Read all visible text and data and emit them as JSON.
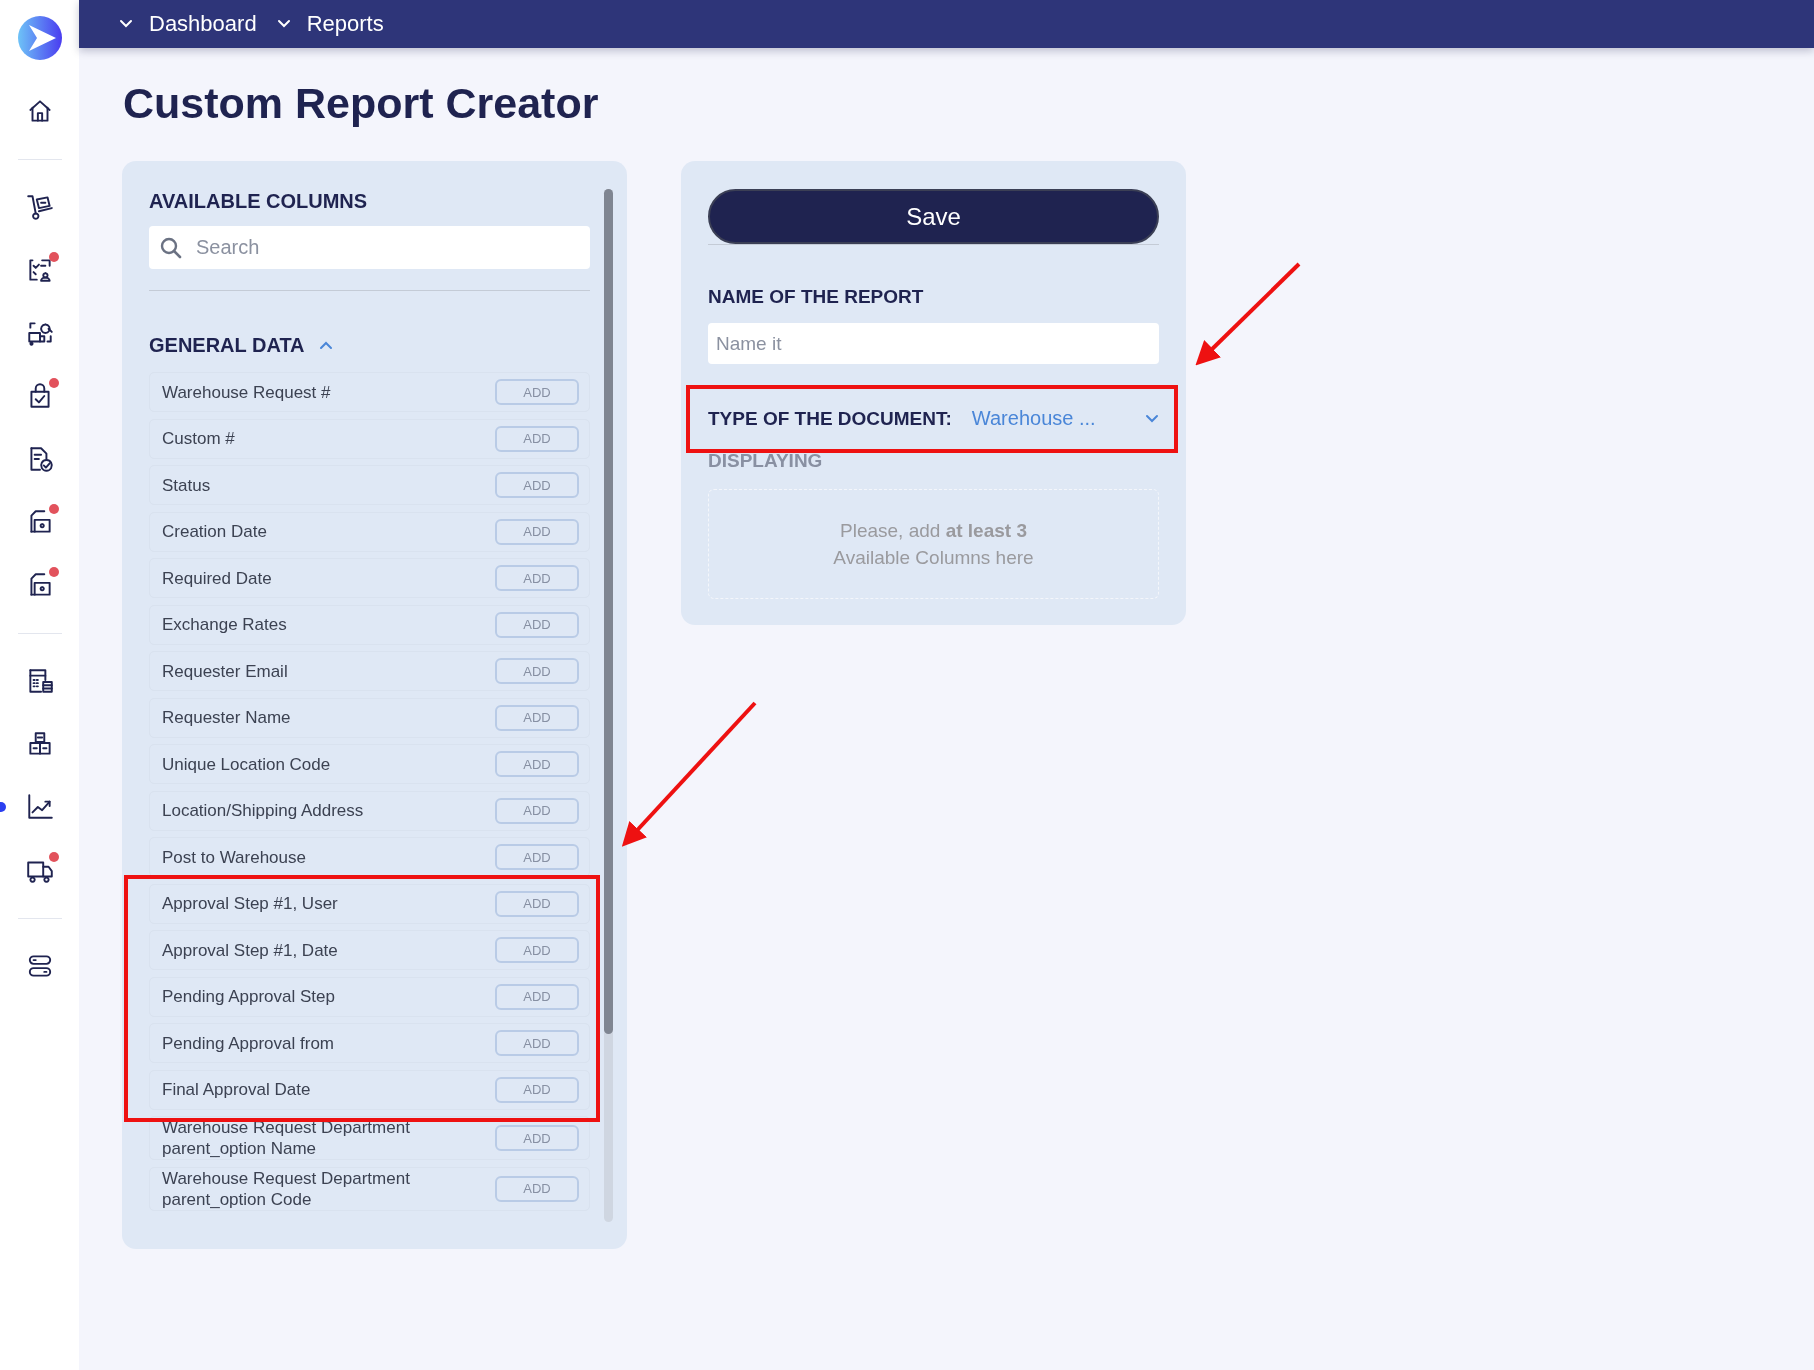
{
  "sidebar": {
    "groups": [
      [
        {
          "alert": false,
          "selected": false
        }
      ],
      [
        {
          "alert": false,
          "selected": false
        },
        {
          "alert": true,
          "selected": false
        },
        {
          "alert": false,
          "selected": false
        },
        {
          "alert": true,
          "selected": false
        },
        {
          "alert": false,
          "selected": false
        },
        {
          "alert": true,
          "selected": false
        },
        {
          "alert": true,
          "selected": false
        }
      ],
      [
        {
          "alert": false,
          "selected": false
        },
        {
          "alert": false,
          "selected": false
        },
        {
          "alert": false,
          "selected": true
        },
        {
          "alert": true,
          "selected": false
        }
      ],
      [
        {
          "alert": false,
          "selected": false
        }
      ]
    ]
  },
  "breadcrumbs": [
    {
      "label": "Dashboard"
    },
    {
      "label": "Reports"
    }
  ],
  "title": "Custom Report Creator",
  "available_columns": {
    "heading": "AVAILABLE COLUMNS",
    "search": {
      "placeholder": "Search"
    },
    "section": {
      "title": "GENERAL DATA",
      "expanded": true
    },
    "rows": [
      {
        "label": "Warehouse Request #",
        "action": "ADD"
      },
      {
        "label": "Custom #",
        "action": "ADD"
      },
      {
        "label": "Status",
        "action": "ADD"
      },
      {
        "label": "Creation Date",
        "action": "ADD"
      },
      {
        "label": "Required Date",
        "action": "ADD"
      },
      {
        "label": "Exchange Rates",
        "action": "ADD"
      },
      {
        "label": "Requester Email",
        "action": "ADD"
      },
      {
        "label": "Requester Name",
        "action": "ADD"
      },
      {
        "label": "Unique Location Code",
        "action": "ADD"
      },
      {
        "label": "Location/Shipping Address",
        "action": "ADD"
      },
      {
        "label": "Post to Warehouse",
        "action": "ADD"
      },
      {
        "label": "Approval Step #1, User",
        "action": "ADD"
      },
      {
        "label": "Approval Step #1, Date",
        "action": "ADD"
      },
      {
        "label": "Pending Approval Step",
        "action": "ADD"
      },
      {
        "label": "Pending Approval from",
        "action": "ADD"
      },
      {
        "label": "Final Approval Date",
        "action": "ADD"
      },
      {
        "label": "Warehouse Request Department parent_option Name",
        "action": "ADD"
      },
      {
        "label": "Warehouse Request Department parent_option Code",
        "action": "ADD"
      }
    ]
  },
  "report": {
    "save_button": "Save",
    "name_label": "NAME OF THE REPORT",
    "name_field": {
      "placeholder": "Name it"
    },
    "type_label": "TYPE OF THE DOCUMENT:",
    "type_value": "Warehouse ...",
    "displaying_label": "DISPLAYING",
    "dropzone_text": "Please, add **at least 3** Available Columns here"
  }
}
